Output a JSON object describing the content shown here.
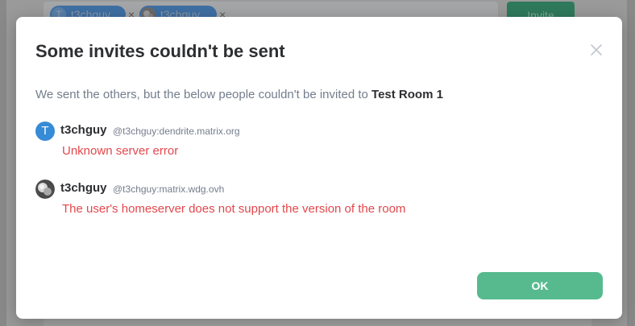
{
  "background": {
    "invite_pills": [
      {
        "avatar_letter": "T",
        "label": "t3chguy",
        "avatar_type": "letter"
      },
      {
        "avatar_letter": "",
        "label": "t3chguy",
        "avatar_type": "image"
      }
    ],
    "pill_remove_glyph": "×",
    "invite_button_label": "Invite"
  },
  "modal": {
    "title": "Some invites couldn't be sent",
    "close_icon": "close-icon",
    "intro_text": "We sent the others, but the below people couldn't be invited to ",
    "room_name": "Test Room 1",
    "failures": [
      {
        "avatar_letter": "T",
        "avatar_type": "letter",
        "display_name": "t3chguy",
        "user_id": "@t3chguy:dendrite.matrix.org",
        "error": "Unknown server error"
      },
      {
        "avatar_letter": "",
        "avatar_type": "image",
        "display_name": "t3chguy",
        "user_id": "@t3chguy:matrix.wdg.ovh",
        "error": "The user's homeserver does not support the version of the room"
      }
    ],
    "ok_label": "OK"
  },
  "colors": {
    "accent": "#0dbd8b",
    "ok_button": "#57ba8e",
    "error": "#e2474c",
    "avatar_blue": "#368bd6",
    "muted_text": "#737d8c",
    "primary_text": "#2e2f32"
  }
}
